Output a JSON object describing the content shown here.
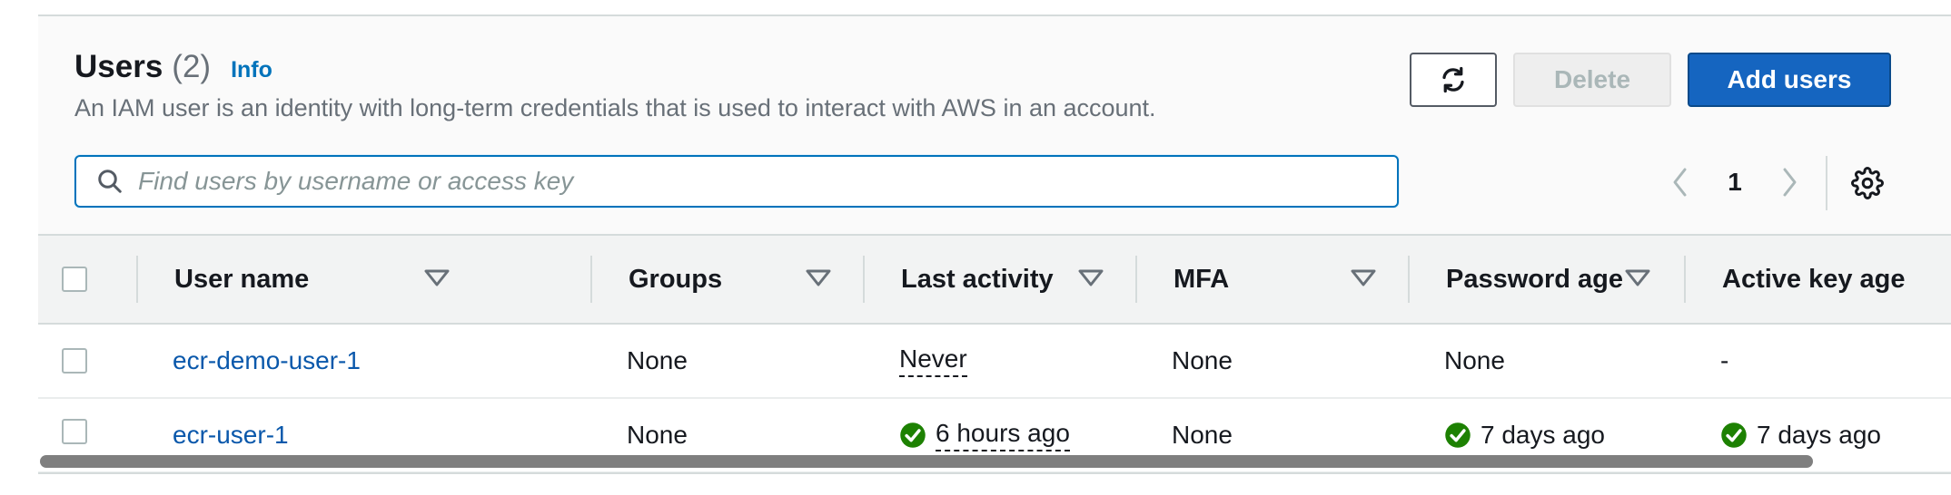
{
  "header": {
    "title": "Users",
    "count": "(2)",
    "info": "Info",
    "description": "An IAM user is an identity with long-term credentials that is used to interact with AWS in an account."
  },
  "toolbar": {
    "refresh_icon": "refresh-icon",
    "delete_label": "Delete",
    "add_label": "Add users"
  },
  "search": {
    "placeholder": "Find users by username or access key",
    "value": ""
  },
  "pagination": {
    "current_page": "1"
  },
  "table": {
    "columns": [
      "User name",
      "Groups",
      "Last activity",
      "MFA",
      "Password age",
      "Active key age"
    ],
    "rows": [
      {
        "user_name": "ecr-demo-user-1",
        "groups": "None",
        "last_activity": "Never",
        "mfa": "None",
        "password_age": "None",
        "active_key_age": "-"
      },
      {
        "user_name": "ecr-user-1",
        "groups": "None",
        "last_activity": "6 hours ago",
        "mfa": "None",
        "password_age": "7 days ago",
        "active_key_age": "7 days ago"
      }
    ]
  },
  "colors": {
    "accent": "#0073bb",
    "primary_button": "#1565c0",
    "success": "#1d8102",
    "link": "#0a58ab"
  }
}
